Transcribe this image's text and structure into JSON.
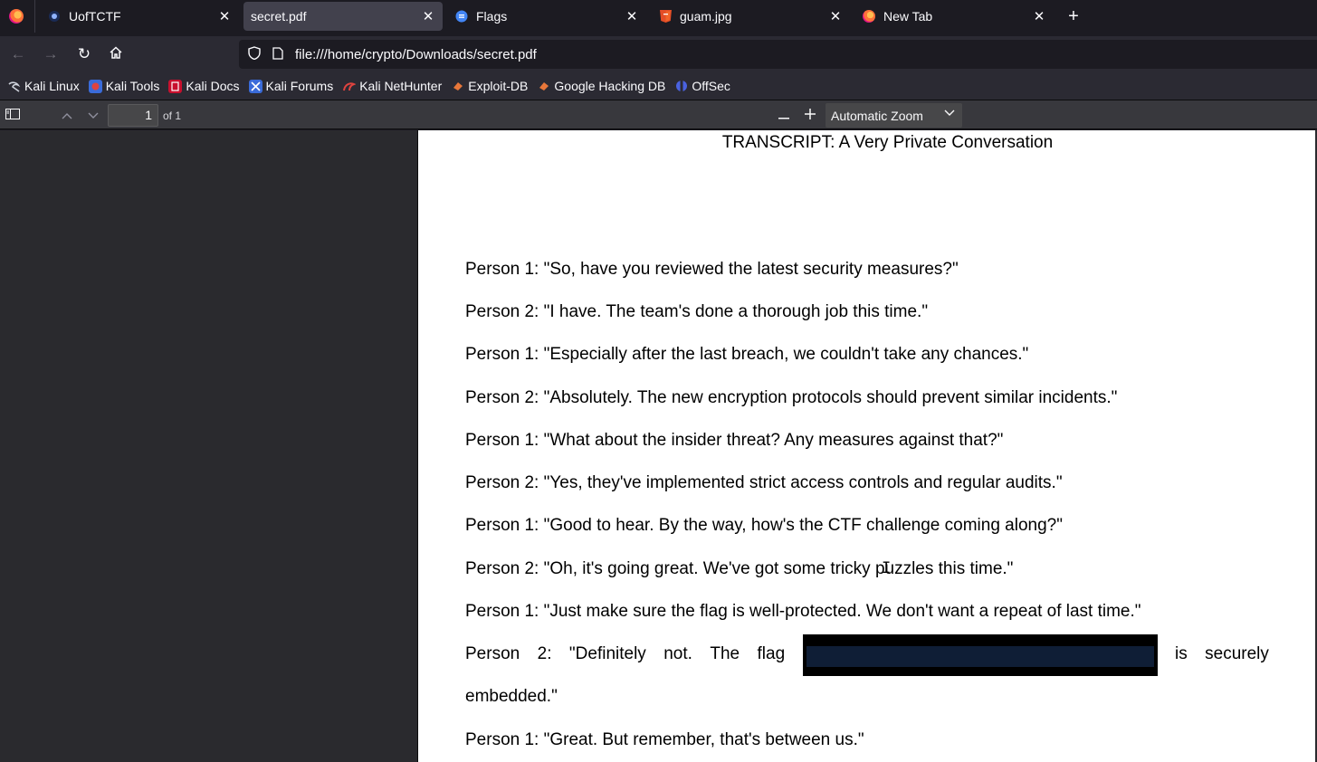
{
  "tabs": [
    {
      "title": "UofTCTF",
      "icon": "ctf-logo-icon",
      "active": false
    },
    {
      "title": "secret.pdf",
      "icon": "",
      "active": true
    },
    {
      "title": "Flags",
      "icon": "doc-icon",
      "active": false
    },
    {
      "title": "guam.jpg",
      "icon": "html5-icon",
      "active": false
    },
    {
      "title": "New Tab",
      "icon": "firefox-icon",
      "active": false
    }
  ],
  "navigation": {
    "url": "file:///home/crypto/Downloads/secret.pdf"
  },
  "bookmarks": [
    {
      "label": "Kali Linux",
      "icon": "kali-dragon-icon",
      "color": "#cfd3dc"
    },
    {
      "label": "Kali Tools",
      "icon": "kali-tools-icon",
      "color": "#e0433f"
    },
    {
      "label": "Kali Docs",
      "icon": "kali-docs-icon",
      "color": "#c8102e"
    },
    {
      "label": "Kali Forums",
      "icon": "kali-forums-icon",
      "color": "#3a6bd9"
    },
    {
      "label": "Kali NetHunter",
      "icon": "nethunter-icon",
      "color": "#e0433f"
    },
    {
      "label": "Exploit-DB",
      "icon": "exploit-db-icon",
      "color": "#e8773a"
    },
    {
      "label": "Google Hacking DB",
      "icon": "ghdb-icon",
      "color": "#e8773a"
    },
    {
      "label": "OffSec",
      "icon": "offsec-icon",
      "color": "#4a62e0"
    }
  ],
  "pdf_toolbar": {
    "page_number": "1",
    "page_count": "of 1",
    "zoom": "Automatic Zoom"
  },
  "document": {
    "title": "TRANSCRIPT: A Very Private Conversation",
    "lines": [
      "Person 1: \"So, have you reviewed the latest security measures?\"",
      "Person 2: \"I have. The team's done a thorough job this time.\"",
      "Person 1: \"Especially after the last breach, we couldn't take any chances.\"",
      "Person 2: \"Absolutely. The new encryption protocols should prevent similar incidents.\"",
      "Person 1: \"What about the insider threat? Any measures against that?\"",
      "Person 2: \"Yes, they've implemented strict access controls and regular audits.\"",
      "Person 1: \"Good to hear. By the way, how's the CTF challenge coming along?\"",
      "Person 2: \"Oh, it's going great. We've got some tricky puzzles this time.\"",
      "Person 1: \"Just make sure the flag is well-protected. We don't want a repeat of last time.\""
    ],
    "flag_line_words": [
      "Person",
      "2:",
      "\"Definitely",
      "not.",
      "The",
      "flag",
      "",
      "is",
      "securely"
    ],
    "flag_line_continuation": "embedded.\"",
    "last_line": "Person 1: \"Great. But remember, that's between us.\""
  },
  "colors": {
    "tab_active_bg": "#42414d",
    "redaction": "#000000",
    "redaction_inner": "#0f1e36"
  }
}
